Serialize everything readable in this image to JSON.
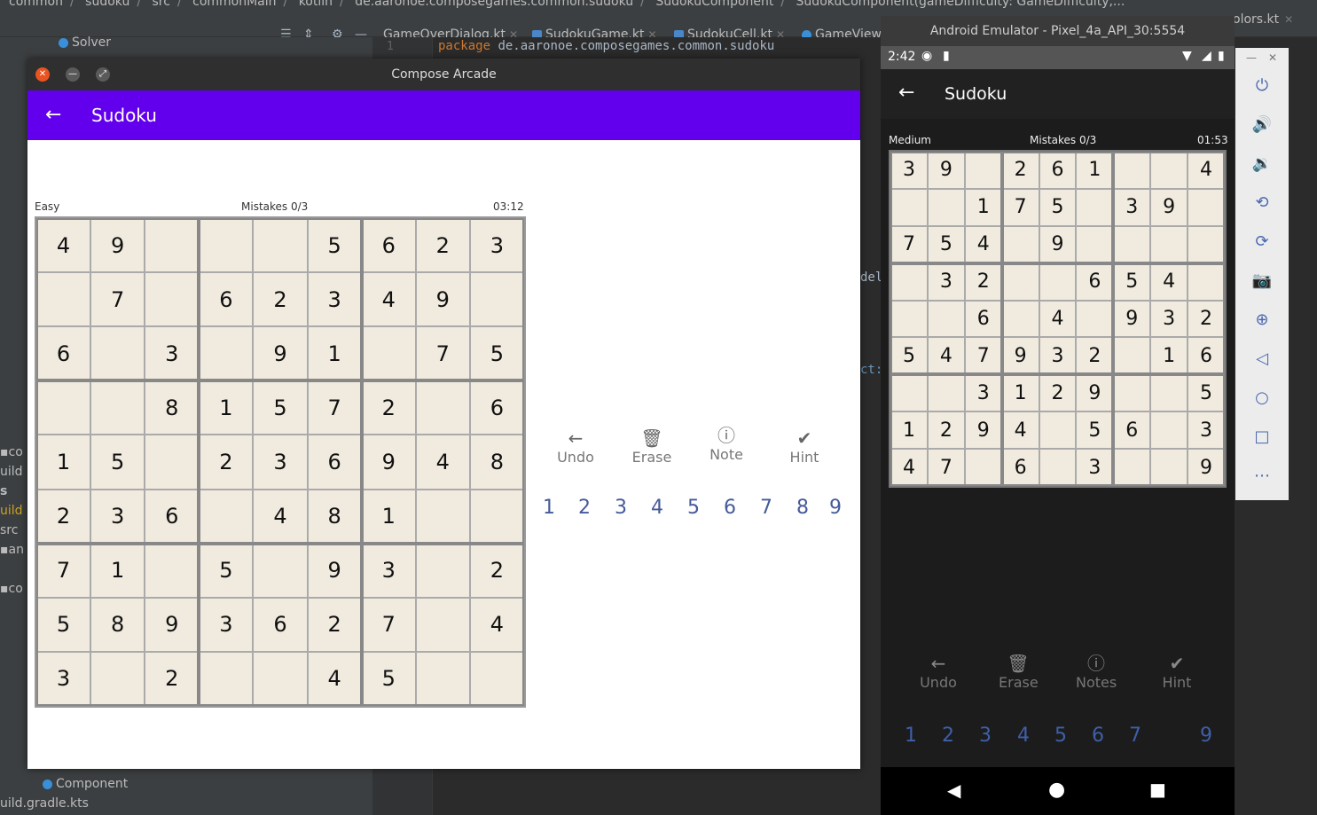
{
  "ide": {
    "breadcrumbs": [
      "common",
      "sudoku",
      "src",
      "commonMain",
      "kotlin",
      "de.aaronoe.composegames.common.sudoku",
      "SudokuComponent",
      "SudokuComponent(gameDifficulty: GameDifficulty,..."
    ],
    "tabs": [
      "GameOverDialog.kt",
      "SudokuGame.kt",
      "SudokuCell.kt",
      "GameView"
    ],
    "right_tab": "olors.kt",
    "line_number": "1",
    "code_keyword": "package",
    "code_package": "de.aaronoe.composegames.common.sudoku",
    "fragment_1": "del",
    "fragment_2": "ct:",
    "project_items": [
      "Solver",
      "co",
      "uild",
      "s",
      "uild",
      "src",
      "an",
      "co",
      "Component",
      "uild.gradle.kts"
    ]
  },
  "desktop": {
    "window_title": "Compose Arcade",
    "appbar_title": "Sudoku",
    "back_icon": "arrow-left-icon",
    "difficulty": "Easy",
    "mistakes": "Mistakes 0/3",
    "timer": "03:12",
    "grid": [
      [
        "4",
        "9",
        "",
        "",
        "",
        "5",
        "6",
        "2",
        "3"
      ],
      [
        "",
        "7",
        "",
        "6",
        "2",
        "3",
        "4",
        "9",
        ""
      ],
      [
        "6",
        "",
        "3",
        "",
        "9",
        "1",
        "",
        "7",
        "5"
      ],
      [
        "",
        "",
        "8",
        "1",
        "5",
        "7",
        "2",
        "",
        "6"
      ],
      [
        "1",
        "5",
        "",
        "2",
        "3",
        "6",
        "9",
        "4",
        "8"
      ],
      [
        "2",
        "3",
        "6",
        "",
        "4",
        "8",
        "1",
        "",
        ""
      ],
      [
        "7",
        "1",
        "",
        "5",
        "",
        "9",
        "3",
        "",
        "2"
      ],
      [
        "5",
        "8",
        "9",
        "3",
        "6",
        "2",
        "7",
        "",
        "4"
      ],
      [
        "3",
        "",
        "2",
        "",
        "",
        "4",
        "5",
        "",
        ""
      ]
    ],
    "actions": [
      {
        "label": "Undo",
        "icon": "undo-arrow-icon"
      },
      {
        "label": "Erase",
        "icon": "trash-icon"
      },
      {
        "label": "Note",
        "icon": "info-icon"
      },
      {
        "label": "Hint",
        "icon": "check-circle-icon"
      }
    ],
    "numpad": [
      "1",
      "2",
      "3",
      "4",
      "5",
      "6",
      "7",
      "8",
      "9"
    ]
  },
  "emulator": {
    "window_title": "Android Emulator - Pixel_4a_API_30:5554",
    "status_time": "2:42",
    "appbar_title": "Sudoku",
    "difficulty": "Medium",
    "mistakes": "Mistakes 0/3",
    "timer": "01:53",
    "grid": [
      [
        "3",
        "9",
        "",
        "2",
        "6",
        "1",
        "",
        "",
        "4"
      ],
      [
        "",
        "",
        "1",
        "7",
        "5",
        "",
        "3",
        "9",
        ""
      ],
      [
        "7",
        "5",
        "4",
        "",
        "9",
        "",
        "",
        "",
        ""
      ],
      [
        "",
        "3",
        "2",
        "",
        "",
        "6",
        "5",
        "4",
        ""
      ],
      [
        "",
        "",
        "6",
        "",
        "4",
        "",
        "9",
        "3",
        "2"
      ],
      [
        "5",
        "4",
        "7",
        "9",
        "3",
        "2",
        "",
        "1",
        "6"
      ],
      [
        "",
        "",
        "3",
        "1",
        "2",
        "9",
        "",
        "",
        "5"
      ],
      [
        "1",
        "2",
        "9",
        "4",
        "",
        "5",
        "6",
        "",
        "3"
      ],
      [
        "4",
        "7",
        "",
        "6",
        "",
        "3",
        "",
        "",
        "9"
      ]
    ],
    "actions": [
      {
        "label": "Undo",
        "icon": "undo-arrow-icon"
      },
      {
        "label": "Erase",
        "icon": "trash-icon"
      },
      {
        "label": "Notes",
        "icon": "info-icon"
      },
      {
        "label": "Hint",
        "icon": "check-circle-icon"
      }
    ],
    "numpad": [
      "1",
      "2",
      "3",
      "4",
      "5",
      "6",
      "7",
      "",
      "9"
    ],
    "sidebar_icons": [
      "power-icon",
      "volume-up-icon",
      "volume-down-icon",
      "rotate-left-icon",
      "rotate-right-icon",
      "camera-icon",
      "zoom-icon",
      "back-icon",
      "home-icon",
      "overview-icon",
      "more-icon"
    ]
  }
}
